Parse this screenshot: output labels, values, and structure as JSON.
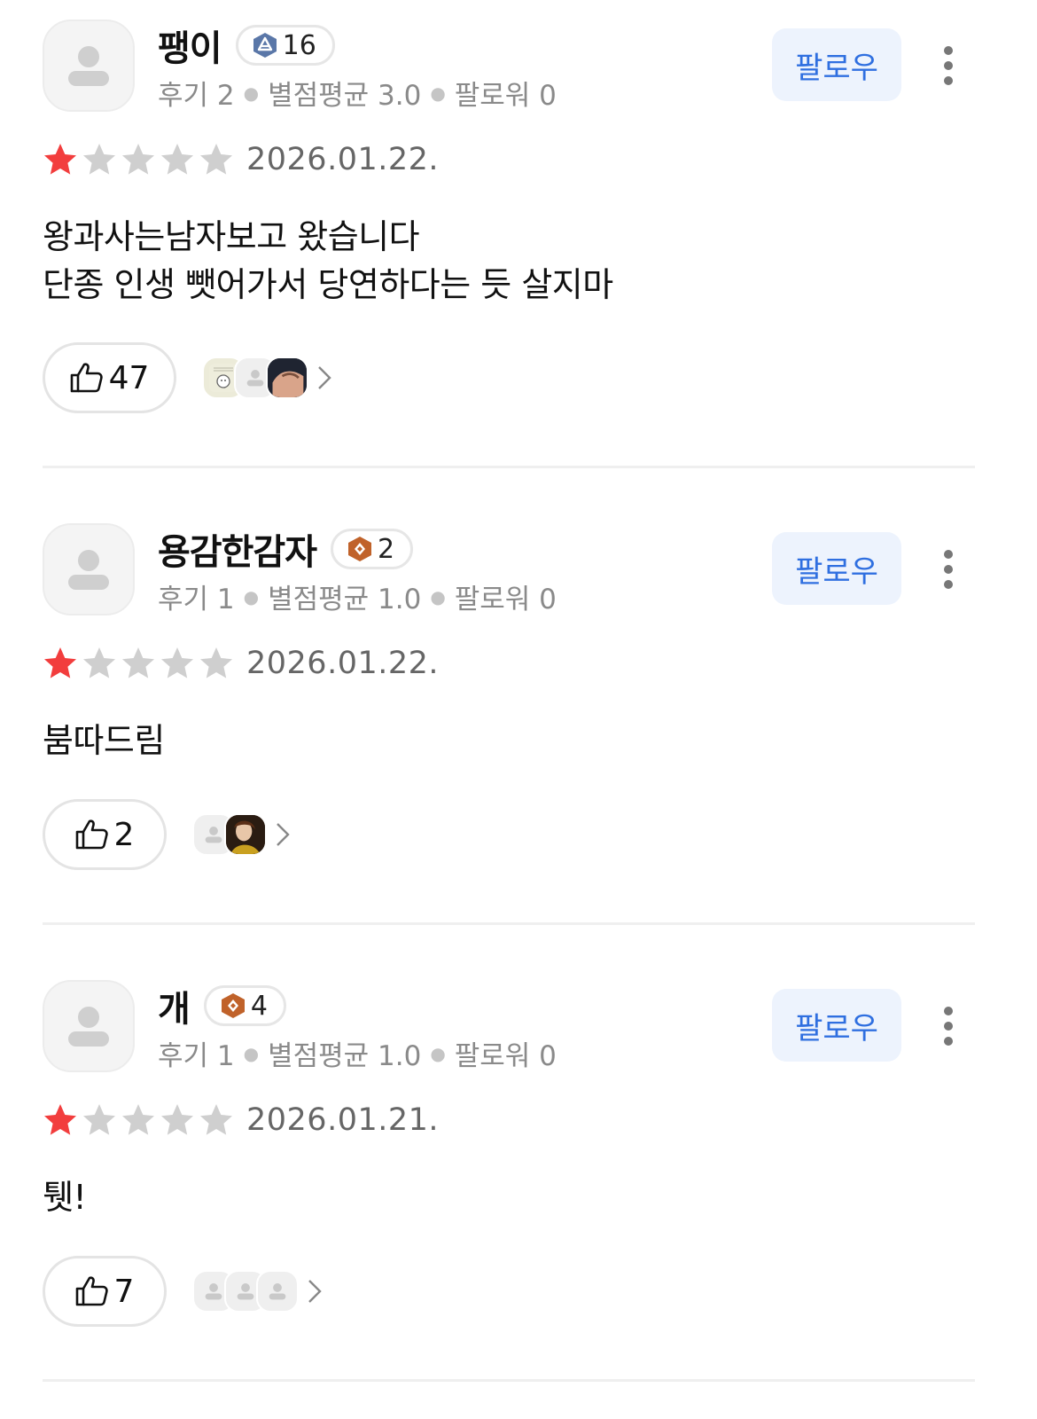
{
  "follow_label": "팔로우",
  "colors": {
    "accent": "#2f6fe0",
    "follow_bg": "#edf3fd",
    "star_filled": "#f23d3d",
    "star_empty": "#cfcfcf",
    "level_blue": "#5a77a8",
    "level_bronze": "#c0622a"
  },
  "reviews": [
    {
      "username": "팽이",
      "level": "16",
      "level_tier_icon": "blue-level-badge-icon",
      "review_count": "후기 2",
      "avg_rating": "별점평균 3.0",
      "followers": "팔로워 0",
      "rating": 1,
      "max_rating": 5,
      "date": "2026.01.22.",
      "text": "왕과사는남자보고 왔습니다\n단종 인생 뺏어가서 당연하다는 듯 살지마",
      "likes": "47",
      "liker_avatars": [
        "custom-image-avatar",
        "default-avatar",
        "photo-avatar"
      ]
    },
    {
      "username": "용감한감자",
      "level": "2",
      "level_tier_icon": "bronze-level-badge-icon",
      "review_count": "후기 1",
      "avg_rating": "별점평균 1.0",
      "followers": "팔로워 0",
      "rating": 1,
      "max_rating": 5,
      "date": "2026.01.22.",
      "text": "붐따드림",
      "likes": "2",
      "liker_avatars": [
        "default-avatar",
        "photo-avatar"
      ]
    },
    {
      "username": "개",
      "level": "4",
      "level_tier_icon": "bronze-level-badge-icon",
      "review_count": "후기 1",
      "avg_rating": "별점평균 1.0",
      "followers": "팔로워 0",
      "rating": 1,
      "max_rating": 5,
      "date": "2026.01.21.",
      "text": "퉷!",
      "likes": "7",
      "liker_avatars": [
        "default-avatar",
        "default-avatar",
        "default-avatar"
      ]
    }
  ]
}
